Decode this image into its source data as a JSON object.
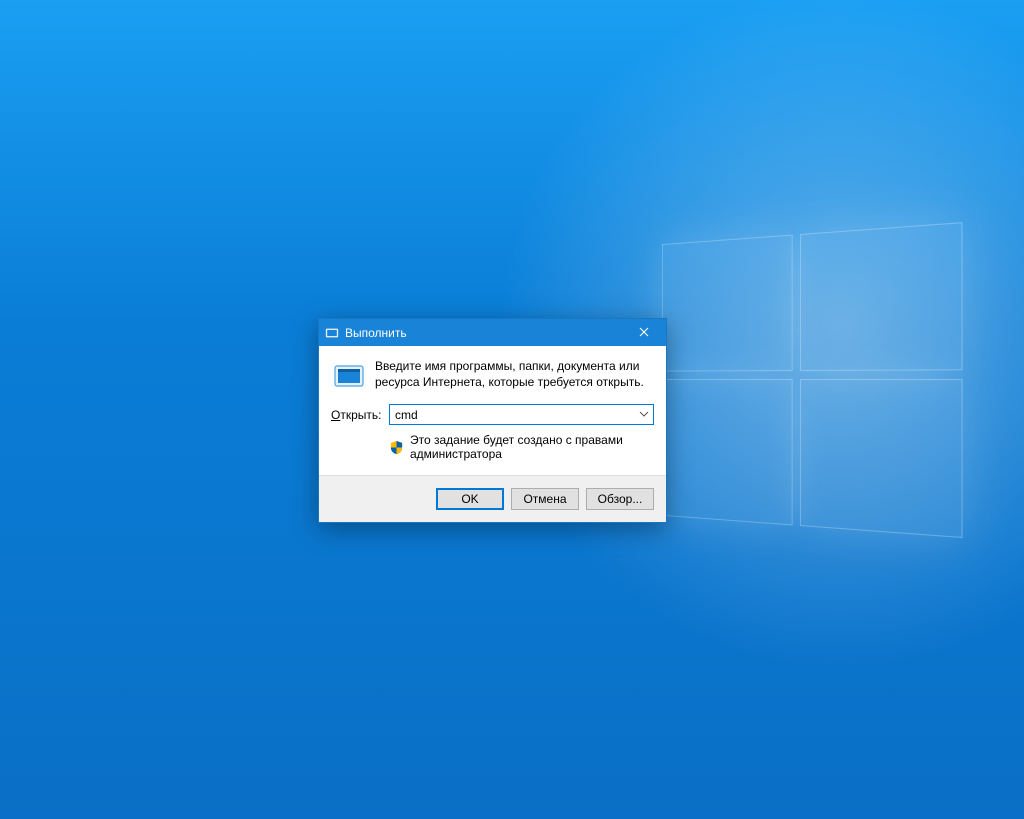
{
  "dialog": {
    "title": "Выполнить",
    "description": "Введите имя программы, папки, документа или ресурса Интернета, которые требуется открыть.",
    "open_label_prefix": "О",
    "open_label_rest": "ткрыть:",
    "open_value": "cmd",
    "admin_note": "Это задание будет создано с правами администратора",
    "buttons": {
      "ok": "OK",
      "cancel": "Отмена",
      "browse": "Обзор..."
    }
  }
}
